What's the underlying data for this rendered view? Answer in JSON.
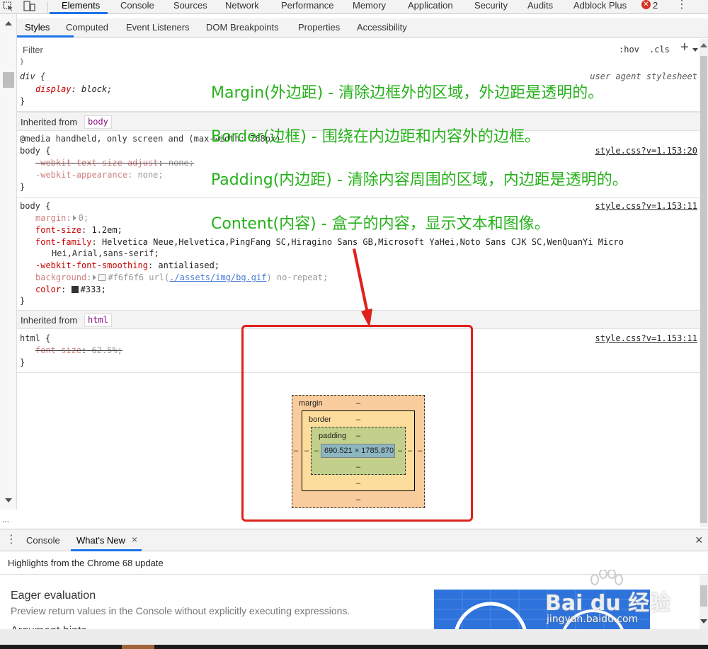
{
  "top_tabs": [
    "Elements",
    "Console",
    "Sources",
    "Network",
    "Performance",
    "Memory",
    "Application",
    "Security",
    "Audits",
    "Adblock Plus"
  ],
  "active_top_tab": "Elements",
  "error_count": "2",
  "sub_tabs": [
    "Styles",
    "Computed",
    "Event Listeners",
    "DOM Breakpoints",
    "Properties",
    "Accessibility"
  ],
  "filter": {
    "placeholder": "Filter",
    "hov": ":hov",
    "cls": ".cls",
    "add": "+"
  },
  "rules": {
    "div_rule": {
      "selector": "div {",
      "source": "user agent stylesheet",
      "prop": "display",
      "value": "block;",
      "close": "}"
    },
    "inherited_body_label": "Inherited from",
    "inherited_body_tag": "body",
    "media_line": "@media handheld, only screen and (max-width: 768px)",
    "body_rule_1": {
      "selector": "body {",
      "source": "style.css?v=1.153:20",
      "p1": "-webkit-text-size-adjust",
      "v1": "none;",
      "p2": "-webkit-appearance",
      "v2": "none;",
      "close": "}"
    },
    "body_rule_2": {
      "selector": "body {",
      "source": "style.css?v=1.153:11",
      "margin_p": "margin",
      "margin_v": "0;",
      "fs_p": "font-size",
      "fs_v": "1.2em;",
      "ff_p": "font-family",
      "ff_v1": "Helvetica Neue,Helvetica,PingFang SC,Hiragino Sans GB,Microsoft YaHei,Noto Sans CJK SC,WenQuanYi Micro",
      "ff_v2": "Hei,Arial,sans-serif;",
      "smooth_p": "-webkit-font-smoothing",
      "smooth_v": "antialiased;",
      "bg_p": "background",
      "bg_color": "#f6f6f6",
      "bg_url_pre": "url(",
      "bg_url": "./assets/img/bg.gif",
      "bg_url_post": ") no-repeat;",
      "color_p": "color",
      "color_v": "#333;",
      "close": "}"
    },
    "inherited_html_label": "Inherited from",
    "inherited_html_tag": "html",
    "html_rule": {
      "selector": "html {",
      "source": "style.css?v=1.153:11",
      "p": "font-size",
      "v": "62.5%;",
      "close": "}"
    }
  },
  "annotations": [
    "Margin(外边距) - 清除边框外的区域，外边距是透明的。",
    "Border(边框) - 围绕在内边距和内容外的边框。",
    "Padding(内边距) - 清除内容周围的区域，内边距是透明的。",
    "Content(内容) - 盒子的内容，显示文本和图像。"
  ],
  "box_model": {
    "margin_label": "margin",
    "border_label": "border",
    "padding_label": "padding",
    "dash": "–",
    "content": "690.521 × 1785.870"
  },
  "drawer": {
    "tabs": [
      "Console",
      "What's New"
    ],
    "active_tab": "What's New",
    "close_tab": "×",
    "close_drawer": "×",
    "highlights": "Highlights from the Chrome 68 update",
    "item_title": "Eager evaluation",
    "item_desc": "Preview return values in the Console without explicitly executing expressions.",
    "next_title": "Argument hints"
  },
  "watermark": {
    "line1": "Bai du 经验",
    "line2": "jingyan.baidu.com"
  },
  "colors": {
    "annotation": "#26b11a",
    "highlight_frame": "#e0201a",
    "accent": "#1a73e8"
  }
}
